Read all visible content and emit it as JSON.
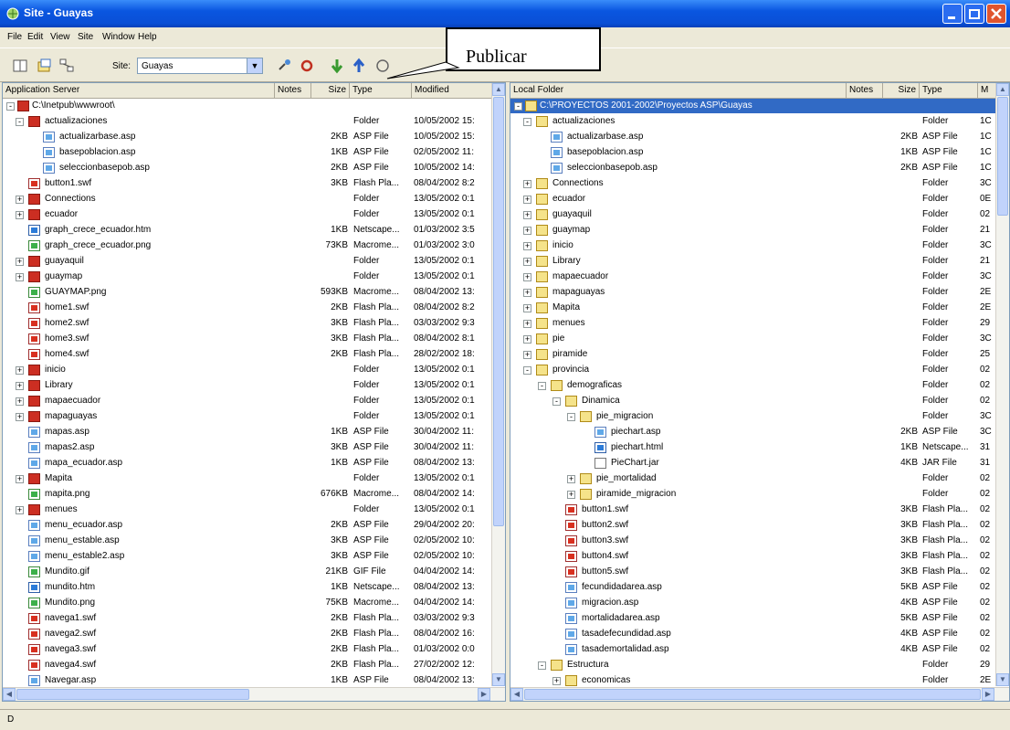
{
  "window": {
    "title": "Site - Guayas",
    "icon": "site-app-icon",
    "buttons": [
      "minimize-icon",
      "maximize-icon",
      "close-icon"
    ]
  },
  "menu": [
    "File",
    "Edit",
    "View",
    "Site",
    "Window",
    "Help"
  ],
  "toolbar": {
    "site_label": "Site:",
    "site_value": "Guayas",
    "icons": [
      "expand-panes-icon",
      "site-files-icon",
      "site-map-icon",
      "connect-icon",
      "refresh-icon",
      "get-icon",
      "put-icon",
      "check-icon"
    ]
  },
  "callout": {
    "text": "Publicar"
  },
  "left_pane": {
    "headers": {
      "name": "Application Server",
      "notes": "Notes",
      "size": "Size",
      "type": "Type",
      "modified": "Modified"
    },
    "root": "C:\\Inetpub\\wwwroot\\",
    "rows": [
      {
        "name": "actualizaciones",
        "size": "",
        "type": "Folder",
        "modified": "10/05/2002 15:",
        "icon": "folder",
        "expand": "-"
      },
      {
        "name": "actualizarbase.asp",
        "size": "2KB",
        "type": "ASP File",
        "modified": "10/05/2002 15:",
        "icon": "asp",
        "expand": ""
      },
      {
        "name": "basepoblacion.asp",
        "size": "1KB",
        "type": "ASP File",
        "modified": "02/05/2002 11:",
        "icon": "asp",
        "expand": ""
      },
      {
        "name": "seleccionbasepob.asp",
        "size": "2KB",
        "type": "ASP File",
        "modified": "10/05/2002 14:",
        "icon": "asp",
        "expand": ""
      },
      {
        "name": "button1.swf",
        "size": "3KB",
        "type": "Flash Pla...",
        "modified": "08/04/2002 8:2",
        "icon": "swf",
        "expand": ""
      },
      {
        "name": "Connections",
        "size": "",
        "type": "Folder",
        "modified": "13/05/2002 0:1",
        "icon": "folder",
        "expand": "+"
      },
      {
        "name": "ecuador",
        "size": "",
        "type": "Folder",
        "modified": "13/05/2002 0:1",
        "icon": "folder",
        "expand": "+"
      },
      {
        "name": "graph_crece_ecuador.htm",
        "size": "1KB",
        "type": "Netscape...",
        "modified": "01/03/2002 3:5",
        "icon": "htm",
        "expand": ""
      },
      {
        "name": "graph_crece_ecuador.png",
        "size": "73KB",
        "type": "Macrome...",
        "modified": "01/03/2002 3:0",
        "icon": "png",
        "expand": ""
      },
      {
        "name": "guayaquil",
        "size": "",
        "type": "Folder",
        "modified": "13/05/2002 0:1",
        "icon": "folder",
        "expand": "+"
      },
      {
        "name": "guaymap",
        "size": "",
        "type": "Folder",
        "modified": "13/05/2002 0:1",
        "icon": "folder",
        "expand": "+"
      },
      {
        "name": "GUAYMAP.png",
        "size": "593KB",
        "type": "Macrome...",
        "modified": "08/04/2002 13:",
        "icon": "png",
        "expand": ""
      },
      {
        "name": "home1.swf",
        "size": "2KB",
        "type": "Flash Pla...",
        "modified": "08/04/2002 8:2",
        "icon": "swf",
        "expand": ""
      },
      {
        "name": "home2.swf",
        "size": "3KB",
        "type": "Flash Pla...",
        "modified": "03/03/2002 9:3",
        "icon": "swf",
        "expand": ""
      },
      {
        "name": "home3.swf",
        "size": "3KB",
        "type": "Flash Pla...",
        "modified": "08/04/2002 8:1",
        "icon": "swf",
        "expand": ""
      },
      {
        "name": "home4.swf",
        "size": "2KB",
        "type": "Flash Pla...",
        "modified": "28/02/2002 18:",
        "icon": "swf",
        "expand": ""
      },
      {
        "name": "inicio",
        "size": "",
        "type": "Folder",
        "modified": "13/05/2002 0:1",
        "icon": "folder",
        "expand": "+"
      },
      {
        "name": "Library",
        "size": "",
        "type": "Folder",
        "modified": "13/05/2002 0:1",
        "icon": "folder",
        "expand": "+"
      },
      {
        "name": "mapaecuador",
        "size": "",
        "type": "Folder",
        "modified": "13/05/2002 0:1",
        "icon": "folder",
        "expand": "+"
      },
      {
        "name": "mapaguayas",
        "size": "",
        "type": "Folder",
        "modified": "13/05/2002 0:1",
        "icon": "folder",
        "expand": "+"
      },
      {
        "name": "mapas.asp",
        "size": "1KB",
        "type": "ASP File",
        "modified": "30/04/2002 11:",
        "icon": "asp",
        "expand": ""
      },
      {
        "name": "mapas2.asp",
        "size": "3KB",
        "type": "ASP File",
        "modified": "30/04/2002 11:",
        "icon": "asp",
        "expand": ""
      },
      {
        "name": "mapa_ecuador.asp",
        "size": "1KB",
        "type": "ASP File",
        "modified": "08/04/2002 13:",
        "icon": "asp",
        "expand": ""
      },
      {
        "name": "Mapita",
        "size": "",
        "type": "Folder",
        "modified": "13/05/2002 0:1",
        "icon": "folder",
        "expand": "+"
      },
      {
        "name": "mapita.png",
        "size": "676KB",
        "type": "Macrome...",
        "modified": "08/04/2002 14:",
        "icon": "png",
        "expand": ""
      },
      {
        "name": "menues",
        "size": "",
        "type": "Folder",
        "modified": "13/05/2002 0:1",
        "icon": "folder",
        "expand": "+"
      },
      {
        "name": "menu_ecuador.asp",
        "size": "2KB",
        "type": "ASP File",
        "modified": "29/04/2002 20:",
        "icon": "asp",
        "expand": ""
      },
      {
        "name": "menu_estable.asp",
        "size": "3KB",
        "type": "ASP File",
        "modified": "02/05/2002 10:",
        "icon": "asp",
        "expand": ""
      },
      {
        "name": "menu_estable2.asp",
        "size": "3KB",
        "type": "ASP File",
        "modified": "02/05/2002 10:",
        "icon": "asp",
        "expand": ""
      },
      {
        "name": "Mundito.gif",
        "size": "21KB",
        "type": "GIF File",
        "modified": "04/04/2002 14:",
        "icon": "png",
        "expand": ""
      },
      {
        "name": "mundito.htm",
        "size": "1KB",
        "type": "Netscape...",
        "modified": "08/04/2002 13:",
        "icon": "htm",
        "expand": ""
      },
      {
        "name": "Mundito.png",
        "size": "75KB",
        "type": "Macrome...",
        "modified": "04/04/2002 14:",
        "icon": "png",
        "expand": ""
      },
      {
        "name": "navega1.swf",
        "size": "2KB",
        "type": "Flash Pla...",
        "modified": "03/03/2002 9:3",
        "icon": "swf",
        "expand": ""
      },
      {
        "name": "navega2.swf",
        "size": "2KB",
        "type": "Flash Pla...",
        "modified": "08/04/2002 16:",
        "icon": "swf",
        "expand": ""
      },
      {
        "name": "navega3.swf",
        "size": "2KB",
        "type": "Flash Pla...",
        "modified": "01/03/2002 0:0",
        "icon": "swf",
        "expand": ""
      },
      {
        "name": "navega4.swf",
        "size": "2KB",
        "type": "Flash Pla...",
        "modified": "27/02/2002 12:",
        "icon": "swf",
        "expand": ""
      },
      {
        "name": "Navegar.asp",
        "size": "1KB",
        "type": "ASP File",
        "modified": "08/04/2002 13:",
        "icon": "asp",
        "expand": ""
      }
    ]
  },
  "right_pane": {
    "headers": {
      "name": "Local Folder",
      "notes": "Notes",
      "size": "Size",
      "type": "Type",
      "modified": "M"
    },
    "root": "C:\\PROYECTOS 2001-2002\\Proyectos ASP\\Guayas",
    "rows": [
      {
        "name": "actualizaciones",
        "size": "",
        "type": "Folder",
        "modified": "1C",
        "icon": "folder",
        "expand": "-"
      },
      {
        "name": "actualizarbase.asp",
        "size": "2KB",
        "type": "ASP File",
        "modified": "1C",
        "icon": "asp",
        "expand": ""
      },
      {
        "name": "basepoblacion.asp",
        "size": "1KB",
        "type": "ASP File",
        "modified": "1C",
        "icon": "asp",
        "expand": ""
      },
      {
        "name": "seleccionbasepob.asp",
        "size": "2KB",
        "type": "ASP File",
        "modified": "1C",
        "icon": "asp",
        "expand": ""
      },
      {
        "name": "Connections",
        "size": "",
        "type": "Folder",
        "modified": "3C",
        "icon": "folder",
        "expand": "+"
      },
      {
        "name": "ecuador",
        "size": "",
        "type": "Folder",
        "modified": "0E",
        "icon": "folder",
        "expand": "+"
      },
      {
        "name": "guayaquil",
        "size": "",
        "type": "Folder",
        "modified": "02",
        "icon": "folder",
        "expand": "+"
      },
      {
        "name": "guaymap",
        "size": "",
        "type": "Folder",
        "modified": "21",
        "icon": "folder",
        "expand": "+"
      },
      {
        "name": "inicio",
        "size": "",
        "type": "Folder",
        "modified": "3C",
        "icon": "folder",
        "expand": "+"
      },
      {
        "name": "Library",
        "size": "",
        "type": "Folder",
        "modified": "21",
        "icon": "folder",
        "expand": "+"
      },
      {
        "name": "mapaecuador",
        "size": "",
        "type": "Folder",
        "modified": "3C",
        "icon": "folder",
        "expand": "+"
      },
      {
        "name": "mapaguayas",
        "size": "",
        "type": "Folder",
        "modified": "2E",
        "icon": "folder",
        "expand": "+"
      },
      {
        "name": "Mapita",
        "size": "",
        "type": "Folder",
        "modified": "2E",
        "icon": "folder",
        "expand": "+"
      },
      {
        "name": "menues",
        "size": "",
        "type": "Folder",
        "modified": "29",
        "icon": "folder",
        "expand": "+"
      },
      {
        "name": "pie",
        "size": "",
        "type": "Folder",
        "modified": "3C",
        "icon": "folder",
        "expand": "+"
      },
      {
        "name": "piramide",
        "size": "",
        "type": "Folder",
        "modified": "25",
        "icon": "folder",
        "expand": "+"
      },
      {
        "name": "provincia",
        "size": "",
        "type": "Folder",
        "modified": "02",
        "icon": "folder",
        "expand": "-"
      },
      {
        "name": "demograficas",
        "size": "",
        "type": "Folder",
        "modified": "02",
        "icon": "folder",
        "expand": "-"
      },
      {
        "name": "Dinamica",
        "size": "",
        "type": "Folder",
        "modified": "02",
        "icon": "folder",
        "expand": "-"
      },
      {
        "name": "pie_migracion",
        "size": "",
        "type": "Folder",
        "modified": "3C",
        "icon": "folder",
        "expand": "-"
      },
      {
        "name": "piechart.asp",
        "size": "2KB",
        "type": "ASP File",
        "modified": "3C",
        "icon": "asp",
        "expand": ""
      },
      {
        "name": "piechart.html",
        "size": "1KB",
        "type": "Netscape...",
        "modified": "31",
        "icon": "htm",
        "expand": ""
      },
      {
        "name": "PieChart.jar",
        "size": "4KB",
        "type": "JAR File",
        "modified": "31",
        "icon": "jar",
        "expand": ""
      },
      {
        "name": "pie_mortalidad",
        "size": "",
        "type": "Folder",
        "modified": "02",
        "icon": "folder",
        "expand": "+"
      },
      {
        "name": "piramide_migracion",
        "size": "",
        "type": "Folder",
        "modified": "02",
        "icon": "folder",
        "expand": "+"
      },
      {
        "name": "button1.swf",
        "size": "3KB",
        "type": "Flash Pla...",
        "modified": "02",
        "icon": "swf",
        "expand": ""
      },
      {
        "name": "button2.swf",
        "size": "3KB",
        "type": "Flash Pla...",
        "modified": "02",
        "icon": "swf",
        "expand": ""
      },
      {
        "name": "button3.swf",
        "size": "3KB",
        "type": "Flash Pla...",
        "modified": "02",
        "icon": "swf",
        "expand": ""
      },
      {
        "name": "button4.swf",
        "size": "3KB",
        "type": "Flash Pla...",
        "modified": "02",
        "icon": "swf",
        "expand": ""
      },
      {
        "name": "button5.swf",
        "size": "3KB",
        "type": "Flash Pla...",
        "modified": "02",
        "icon": "swf",
        "expand": ""
      },
      {
        "name": "fecundidadarea.asp",
        "size": "5KB",
        "type": "ASP File",
        "modified": "02",
        "icon": "asp",
        "expand": ""
      },
      {
        "name": "migracion.asp",
        "size": "4KB",
        "type": "ASP File",
        "modified": "02",
        "icon": "asp",
        "expand": ""
      },
      {
        "name": "mortalidadarea.asp",
        "size": "5KB",
        "type": "ASP File",
        "modified": "02",
        "icon": "asp",
        "expand": ""
      },
      {
        "name": "tasadefecundidad.asp",
        "size": "4KB",
        "type": "ASP File",
        "modified": "02",
        "icon": "asp",
        "expand": ""
      },
      {
        "name": "tasademortalidad.asp",
        "size": "4KB",
        "type": "ASP File",
        "modified": "02",
        "icon": "asp",
        "expand": ""
      },
      {
        "name": "Estructura",
        "size": "",
        "type": "Folder",
        "modified": "29",
        "icon": "folder",
        "expand": "-"
      },
      {
        "name": "economicas",
        "size": "",
        "type": "Folder",
        "modified": "2E",
        "icon": "folder",
        "expand": "+"
      }
    ]
  },
  "statusbar": {
    "text": "D"
  }
}
